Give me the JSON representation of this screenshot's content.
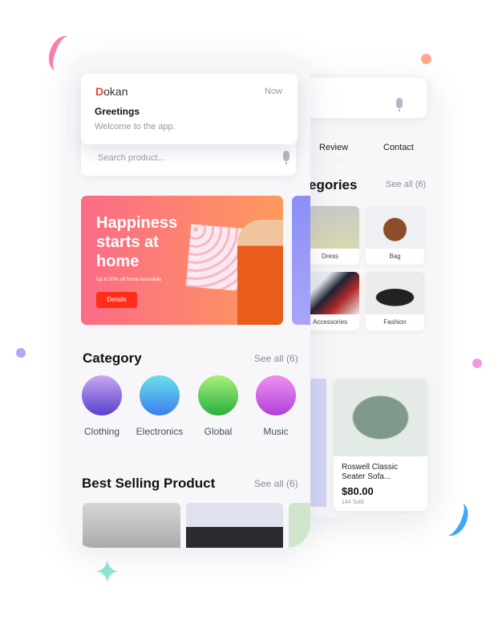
{
  "notification": {
    "app": "Dokan",
    "time": "Now",
    "title": "Greetings",
    "message": "Welcome to the app."
  },
  "search": {
    "placeholder": "Search product..."
  },
  "banner": {
    "headline": "Happiness starts at home",
    "subtext": "Up to 50% off home essentials",
    "button": "Details"
  },
  "category": {
    "title": "Category",
    "see_all": "See all (6)",
    "items": [
      {
        "label": "Clothing"
      },
      {
        "label": "Electronics"
      },
      {
        "label": "Global"
      },
      {
        "label": "Music"
      }
    ]
  },
  "best_selling": {
    "title": "Best Selling Product",
    "see_all": "See all (6)"
  },
  "back_screen": {
    "tabs": [
      "Review",
      "Contact"
    ],
    "categories_title": "egories",
    "see_all": "See all (6)",
    "grid": [
      {
        "label": "Dress"
      },
      {
        "label": "Bag"
      },
      {
        "label": "Accessories"
      },
      {
        "label": "Fashion"
      }
    ],
    "product": {
      "name": "Roswell Classic Seater Sofa...",
      "price": "$80.00",
      "sold": "144 Sold"
    }
  },
  "colors": {
    "accent": "#ff2d1a",
    "banner_start": "#fb6b87",
    "banner_end": "#fe9a5c",
    "brand_logo": "#e8493a"
  }
}
